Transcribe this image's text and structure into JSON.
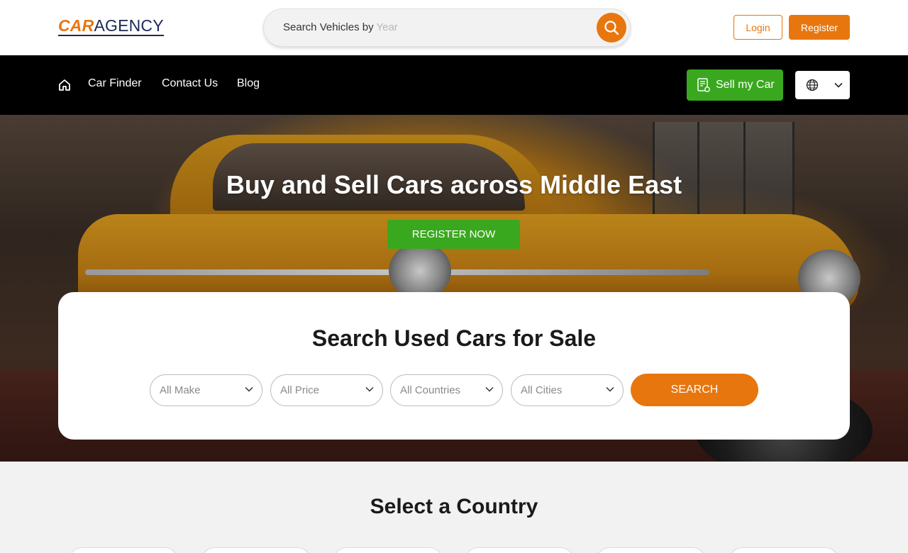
{
  "brand": {
    "part1": "CAR",
    "part2": "AGENCY",
    "accent_color": "#e8760f",
    "navy_color": "#1d2a55"
  },
  "search": {
    "prefix": "Search Vehicles by ",
    "suffix": "Year",
    "icon": "search-icon"
  },
  "header": {
    "login_label": "Login",
    "register_label": "Register"
  },
  "nav": {
    "home_icon": "home-icon",
    "links": [
      "Car Finder",
      "Contact Us",
      "Blog"
    ],
    "sell_label": "Sell my Car",
    "sell_icon": "car-document-icon",
    "sell_color": "#3aa81f",
    "language_icon": "globe-icon"
  },
  "hero": {
    "title": "Buy and Sell Cars across Middle East",
    "cta_label": "REGISTER NOW"
  },
  "search_card": {
    "title": "Search Used Cars for Sale",
    "filters": [
      "All Make",
      "All Price",
      "All Countries",
      "All Cities"
    ],
    "submit_label": "SEARCH"
  },
  "countries": {
    "title": "Select a Country"
  }
}
